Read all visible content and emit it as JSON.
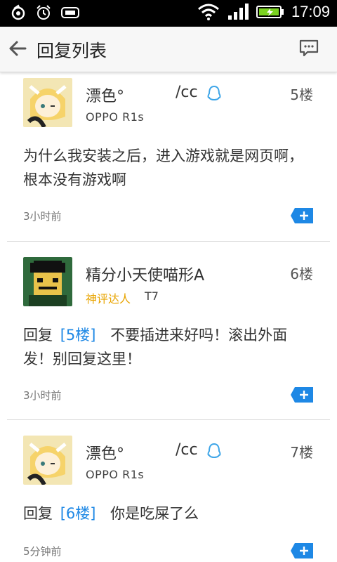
{
  "status_bar": {
    "time": "17:09",
    "icons": [
      "app-notification-icon",
      "alarm-icon",
      "gamepad-icon",
      "wifi-icon",
      "signal-icon",
      "battery-charging-icon"
    ]
  },
  "header": {
    "title": "回复列表",
    "back_icon": "back-arrow-icon",
    "action_icon": "message-icon"
  },
  "posts": [
    {
      "username_left": "漂色°",
      "username_right": "/cc",
      "floor": "5楼",
      "sub": "OPPO R1s",
      "content": "为什么我安装之后，进入游戏就是网页啊，根本没有游戏啊",
      "time": "3小时前"
    },
    {
      "username": "精分小天使喵形A",
      "floor": "6楼",
      "badge": "神评达人",
      "level": "T7",
      "reply_word": "回复",
      "reply_floor": "[5楼]",
      "content": "不要插进来好吗！滚出外面发！别回复这里！",
      "time": "3小时前"
    },
    {
      "username_left": "漂色°",
      "username_right": "/cc",
      "floor": "7楼",
      "sub": "OPPO R1s",
      "reply_word": "回复",
      "reply_floor": "[6楼]",
      "content": "你是吃屎了么",
      "time": "5分钟前"
    }
  ],
  "colors": {
    "accent_blue": "#1e88e5",
    "badge_gold": "#e8a400",
    "status_bar": "#000000"
  }
}
